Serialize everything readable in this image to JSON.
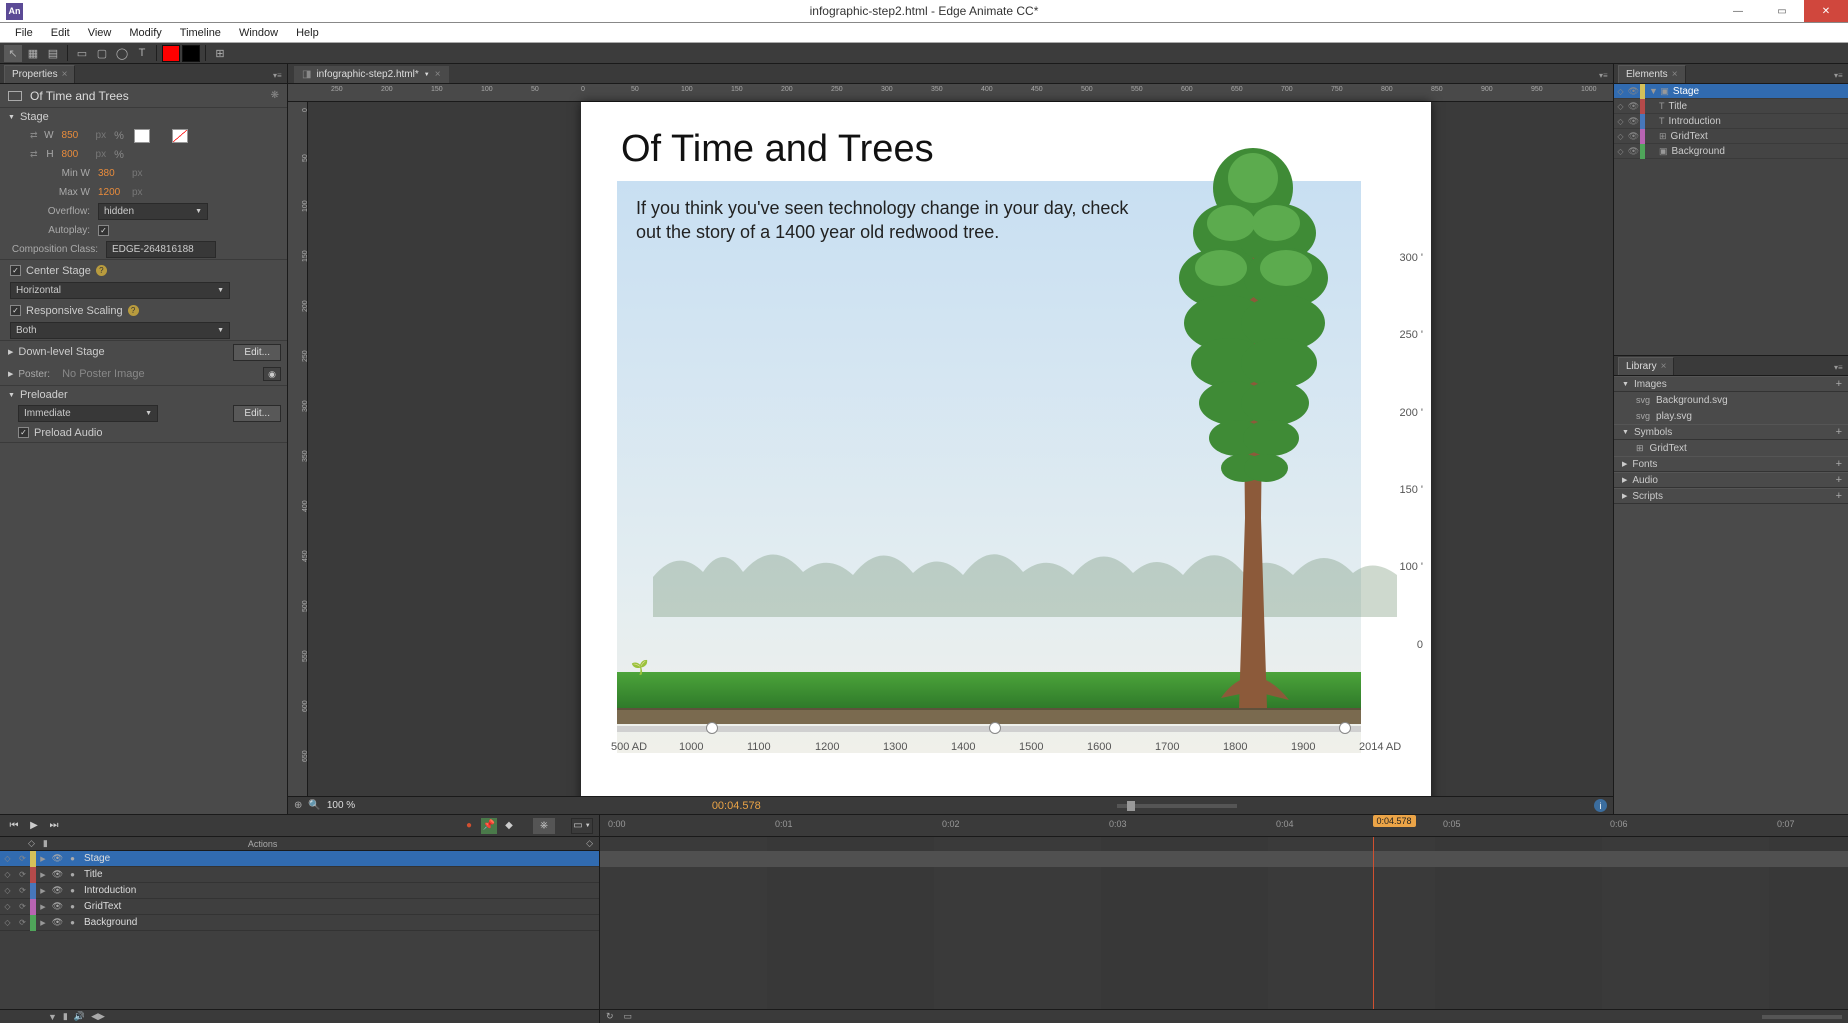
{
  "window": {
    "title": "infographic-step2.html - Edge Animate CC*"
  },
  "menu": [
    "File",
    "Edit",
    "View",
    "Modify",
    "Timeline",
    "Window",
    "Help"
  ],
  "document": {
    "tab": "infographic-step2.html*"
  },
  "properties": {
    "tab": "Properties",
    "element_name": "Of Time and Trees",
    "sections": {
      "stage": "Stage",
      "W": "850",
      "W_unit": "px",
      "H": "800",
      "H_unit": "px",
      "MinW_lbl": "Min W",
      "MinW": "380",
      "MinW_unit": "px",
      "MaxW_lbl": "Max W",
      "MaxW": "1200",
      "MaxW_unit": "px",
      "Overflow_lbl": "Overflow:",
      "Overflow": "hidden",
      "Autoplay_lbl": "Autoplay:",
      "CompClass_lbl": "Composition Class:",
      "CompClass": "EDGE-264816188",
      "CenterStage": "Center Stage",
      "CenterStage_val": "Horizontal",
      "Responsive": "Responsive Scaling",
      "Responsive_val": "Both",
      "DownLevel": "Down-level Stage",
      "Edit": "Edit...",
      "Poster_lbl": "Poster:",
      "Poster": "No Poster Image",
      "Preloader": "Preloader",
      "Preloader_val": "Immediate",
      "PreloadAudio": "Preload Audio"
    }
  },
  "stage": {
    "title_text": "Of Time and Trees",
    "intro_text": "If you think you've seen technology change in your day, check out the story of a 1400 year old redwood tree.",
    "x_ticks": [
      "500 AD",
      "1000",
      "1100",
      "1200",
      "1300",
      "1400",
      "1500",
      "1600",
      "1700",
      "1800",
      "1900",
      "2014 AD"
    ],
    "y_ticks": [
      "0",
      "100 '",
      "150 '",
      "200 '",
      "250 '",
      "300 '"
    ]
  },
  "zoom": {
    "pct": "100 %",
    "time": "00:04.578"
  },
  "elements": {
    "tab": "Elements",
    "rows": [
      {
        "color": "#d4c05a",
        "name": "Stage",
        "tag": "<div>",
        "depth": 0,
        "icon": "stage",
        "sel": true
      },
      {
        "color": "#b54a4a",
        "name": "Title",
        "tag": "<div>",
        "depth": 1,
        "icon": "T"
      },
      {
        "color": "#4777bb",
        "name": "Introduction",
        "tag": "<div>",
        "depth": 1,
        "icon": "T"
      },
      {
        "color": "#b864b2",
        "name": "GridText",
        "tag": "<div>",
        "depth": 1,
        "icon": "sym"
      },
      {
        "color": "#4fa55a",
        "name": "Background",
        "tag": "<div>",
        "depth": 1,
        "icon": "img"
      }
    ]
  },
  "library": {
    "tab": "Library",
    "images": {
      "h": "Images",
      "items": [
        "Background.svg",
        "play.svg"
      ]
    },
    "symbols": {
      "h": "Symbols",
      "items": [
        "GridText"
      ]
    },
    "fonts": "Fonts",
    "audio": "Audio",
    "scripts": "Scripts"
  },
  "timeline": {
    "actions_h": "Actions",
    "tracks": [
      "Stage",
      "Title",
      "Introduction",
      "GridText",
      "Background"
    ],
    "colors": [
      "#d4c05a",
      "#b54a4a",
      "#4777bb",
      "#b864b2",
      "#4fa55a"
    ],
    "ruler": [
      "0:00",
      "0:01",
      "0:02",
      "0:03",
      "0:04",
      "0:05",
      "0:06",
      "0:07"
    ],
    "playhead": "0:04.578"
  }
}
